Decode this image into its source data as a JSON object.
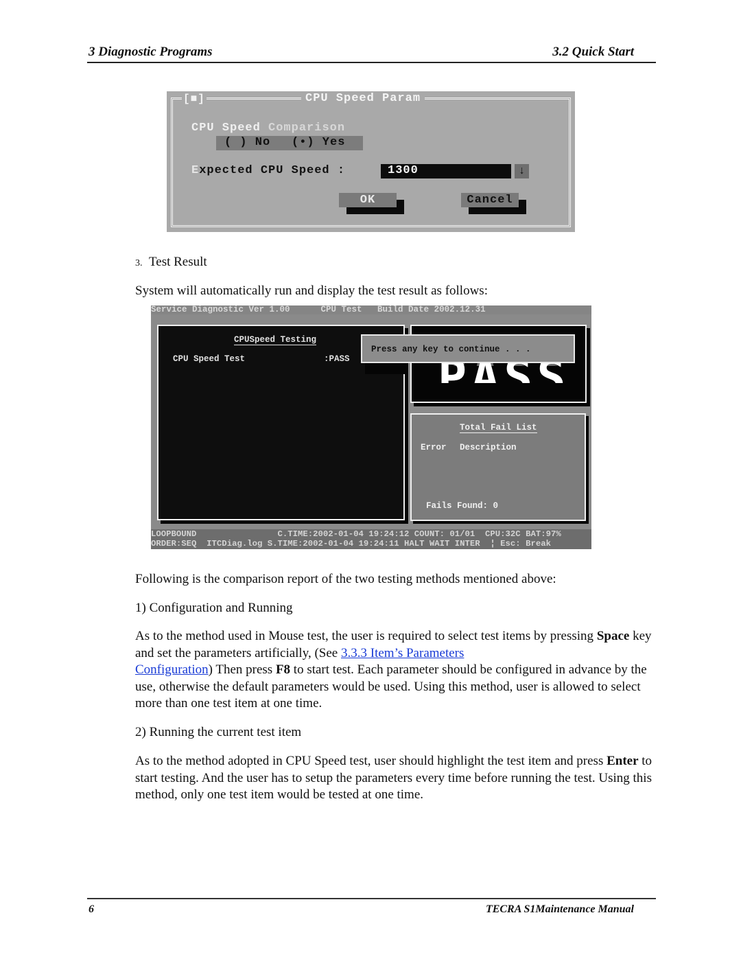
{
  "header": {
    "left": "3  Diagnostic Programs",
    "right": "3.2 Quick Start"
  },
  "footer": {
    "page_number": "6",
    "manual_title": "TECRA S1Maintenance Manual"
  },
  "dialog": {
    "system_box": "[■]",
    "title": "CPU Speed Param",
    "comparison_label_a": "CPU Speed ",
    "comparison_label_b": "Comparison",
    "radio_no": "( ) No",
    "radio_yes": "(•) Yes",
    "selected": "Yes",
    "expected_hotkey": "E",
    "expected_label_rest": "xpected CPU Speed  :",
    "expected_value": "1300",
    "dropdown_icon": "↓",
    "ok_label": "OK",
    "cancel_label": "Cancel"
  },
  "step3": {
    "number": "3.",
    "title": "Test Result"
  },
  "intro": "System will automatically run and display the test result as follows:",
  "diag": {
    "topbar": "Service Diagnostic Ver 1.00      CPU Test   Build Date 2002.12.31",
    "left_panel": {
      "heading": "CPUSpeed Testing",
      "item": "CPU Speed Test",
      "result": ":PASS"
    },
    "big_result": "PASS",
    "popup": "Press any key to continue . . .",
    "fail_panel": {
      "heading": "Total Fail List",
      "col_error": "Error",
      "col_description": "Description",
      "fails_found": "Fails Found: 0"
    },
    "status_line1": "LOOPBOUND                C.TIME:2002-01-04 19:24:12 COUNT: 01/01  CPU:32C BAT:97%",
    "status_line2": "ORDER:SEQ  ITCDiag.log S.TIME:2002-01-04 19:24:11 HALT WAIT INTER  ¦ Esc: Break"
  },
  "comparison_intro": "Following is the comparison report of the two testing methods mentioned above:",
  "section1": {
    "title": "1) Configuration and Running",
    "t1": "As to the method used in Mouse test, the user is required to select test items by pressing ",
    "b1": "Space",
    "t2": " key and set the parameters artificially, (See ",
    "link1": "3.3.3 Item’s Parameters",
    "link2": "Configuration",
    "t3": ") Then press ",
    "b2": "F8",
    "t4": " to start test. Each parameter should be configured in advance by the use, otherwise the default parameters would be used. Using this method, user is allowed to select more than one test item at one time."
  },
  "section2": {
    "title": "2) Running the current test item",
    "t1": "As to the method adopted in CPU Speed test, user should highlight the test item and press ",
    "b1": "Enter",
    "t2": " to start testing. And the user has to setup the parameters every time before running the test. Using this method, only one test item would be tested at one time."
  }
}
